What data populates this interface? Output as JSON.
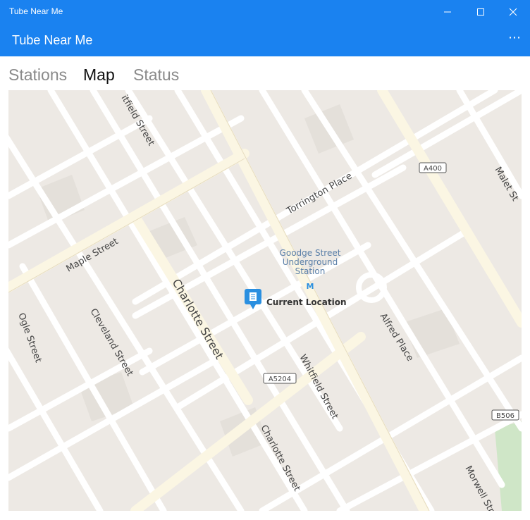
{
  "window": {
    "title": "Tube Near Me",
    "controls": [
      "minimize-icon",
      "maximize-icon",
      "close-icon"
    ]
  },
  "app_bar": {
    "title": "Tube Near Me",
    "more_label": "⋯"
  },
  "tabs": [
    {
      "label": "Stations",
      "active": false
    },
    {
      "label": "Map",
      "active": true
    },
    {
      "label": "Status",
      "active": false
    }
  ],
  "map": {
    "streets": {
      "charlotte_upper": "Charlotte Street",
      "charlotte_lower": "Charlotte Street",
      "whitfield_upper": "itfield Street",
      "whitfield_lower": "Whitfield Street",
      "maple": "Maple Street",
      "torrington": "Torrington Place",
      "cleveland": "Cleveland Street",
      "ogle": "Ogle Street",
      "alfred": "Alfred Place",
      "malet": "Malet St",
      "morwell": "Morwell Street"
    },
    "road_shields": [
      "A400",
      "A5204",
      "B506"
    ],
    "station": {
      "line1": "Goodge Street",
      "line2": "Underground",
      "line3": "Station",
      "icon": "underground-icon"
    },
    "current_location": {
      "label": "Current Location",
      "icon": "location-pin-icon"
    },
    "colors": {
      "land": "#ede9e4",
      "road": "#ffffff",
      "major_road": "#fbf6e3",
      "park": "#cfe6c7",
      "pin": "#2a8fe0",
      "chrome": "#1a82f0"
    }
  }
}
